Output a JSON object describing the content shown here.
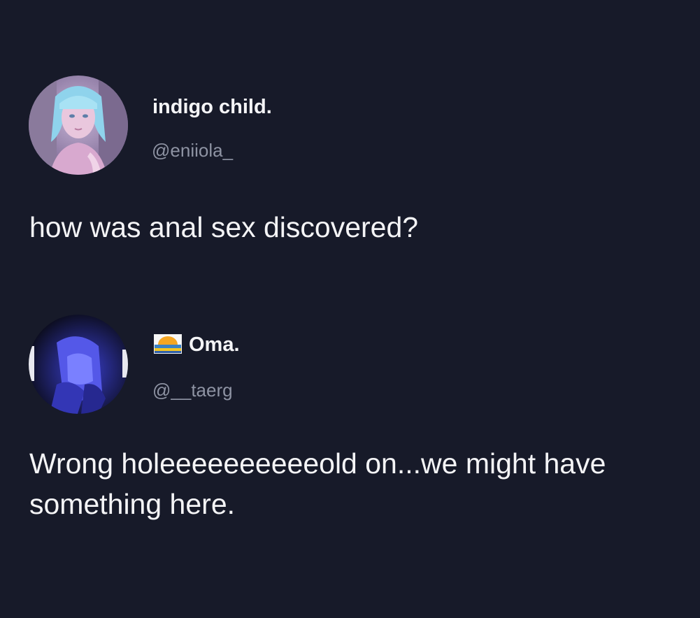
{
  "tweets": [
    {
      "display_name": "indigo child.",
      "handle": "@eniiola_",
      "text": "how was anal sex discovered?",
      "avatar_icon": "anime-girl-avatar-icon"
    },
    {
      "display_name": "Oma.",
      "handle": "@__taerg",
      "text": "Wrong holeeeeeeeeeeold on...we might have something here.",
      "avatar_icon": "dark-blue-character-avatar-icon",
      "name_badge_icon": "sunset-flag-icon"
    }
  ],
  "colors": {
    "background": "#171a29",
    "text_primary": "#f4f4f6",
    "text_secondary": "#8e93a3"
  }
}
